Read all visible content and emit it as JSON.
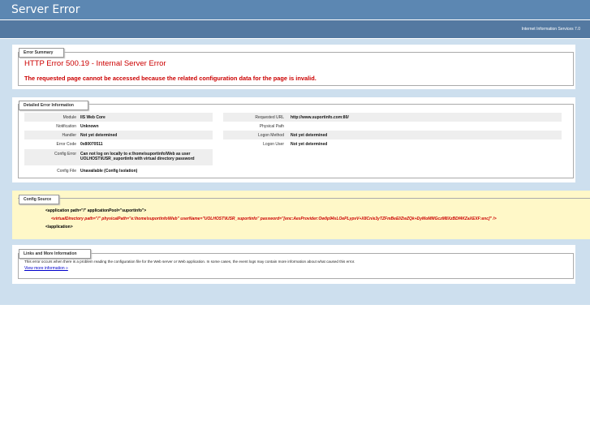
{
  "header": {
    "title": "Server Error"
  },
  "subheader": {
    "product": "Internet Information Services 7.0"
  },
  "error_summary": {
    "legend": "Error Summary",
    "title": "HTTP Error 500.19 - Internal Server Error",
    "message": "The requested page cannot be accessed because the related configuration data for the page is invalid."
  },
  "detailed": {
    "legend": "Detailed Error Information",
    "left": [
      {
        "label": "Module",
        "value": "IIS Web Core"
      },
      {
        "label": "Notification",
        "value": "Unknown"
      },
      {
        "label": "Handler",
        "value": "Not yet determined"
      },
      {
        "label": "Error Code",
        "value": "0x80070511"
      },
      {
        "label": "Config Error",
        "value": "Can not log on locally to e:\\home\\suportinfo\\Web as user UOLHOST\\IUSR_suportinfo with virtual directory password"
      },
      {
        "label": "Config File",
        "value": "Unavailable (Config Isolation)"
      }
    ],
    "right": [
      {
        "label": "Requested URL",
        "value": "http://www.suportinfo.com:80/"
      },
      {
        "label": "Physical Path",
        "value": ""
      },
      {
        "label": "Logon Method",
        "value": "Not yet determined"
      },
      {
        "label": "Logon User",
        "value": "Not yet determined"
      }
    ]
  },
  "config_source": {
    "legend": "Config Source",
    "line1": "<application path=\"/\" applicationPool=\"suportinfo\">",
    "line2": "<virtualDirectory path=\"/\" physicalPath=\"e:\\home\\suportinfo\\Web\" userName=\"UOLHOST\\IUSR_suportinfo\" password=\"[enc:AesProvider:Ow0p94sLOePLypvV+X8Cn/e3yTZFmBeEl/ZwZQk+DyMoMMGczM8XzBDf4KZaXEXF:enc]\" />",
    "line3": "</application>"
  },
  "links": {
    "legend": "Links and More Information",
    "text": "This error occurs when there is a problem reading the configuration file for the Web server or Web application. In some cases, the event logs may contain more information about what caused this error.",
    "more_link": "View more information »"
  }
}
